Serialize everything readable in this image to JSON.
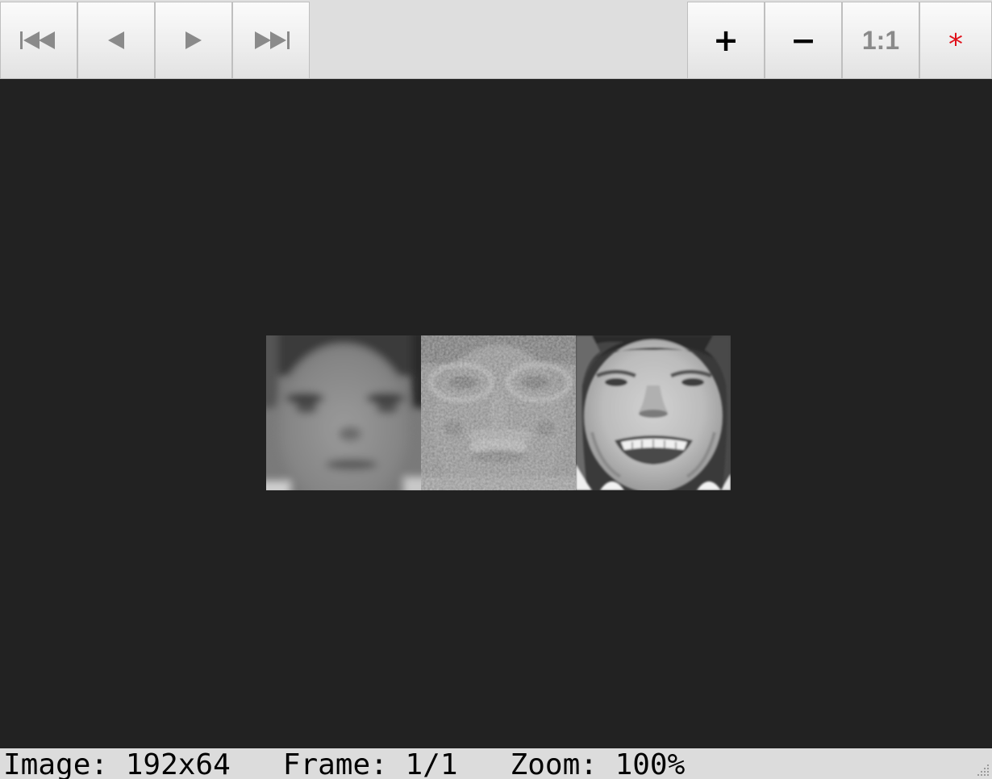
{
  "toolbar": {
    "buttons": {
      "first": {
        "icon": "skip-to-first-icon"
      },
      "prev": {
        "icon": "previous-frame-icon"
      },
      "next": {
        "icon": "next-frame-icon"
      },
      "last": {
        "icon": "skip-to-last-icon"
      },
      "zoom_in": {
        "label": "+"
      },
      "zoom_out": {
        "label": "−"
      },
      "actual_size": {
        "label": "1:1"
      },
      "star": {
        "label": "*"
      }
    },
    "colors": {
      "icon_gray": "#8a8a8a",
      "star_red": "#e0101a",
      "background": "#dedede"
    }
  },
  "viewer": {
    "background": "#222222",
    "image": {
      "tiles": [
        "face-mean",
        "face-eigen",
        "face-photo"
      ]
    }
  },
  "status": {
    "text": "Image: 192x64   Frame: 1/1   Zoom: 100%"
  }
}
